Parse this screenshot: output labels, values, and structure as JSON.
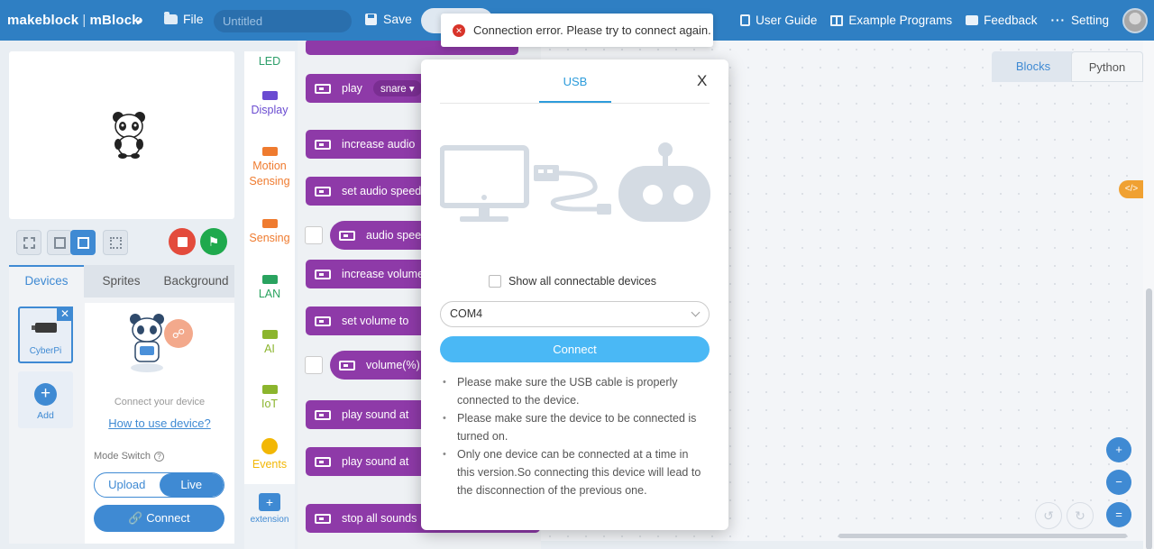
{
  "topbar": {
    "brand": "makeblock",
    "product": "mBlock",
    "file_label": "File",
    "title_placeholder": "Untitled",
    "save_label": "Save",
    "user_guide": "User Guide",
    "example_programs": "Example Programs",
    "feedback": "Feedback",
    "setting": "Setting"
  },
  "toast": {
    "message": "Connection error. Please try to connect again."
  },
  "devices": {
    "tabs": [
      "Devices",
      "Sprites",
      "Background"
    ],
    "device_name": "CyberPi",
    "add_label": "Add",
    "connect_hint": "Connect your device",
    "how_to": "How to use device?",
    "mode_switch_label": "Mode Switch",
    "mode_options": [
      "Upload",
      "Live"
    ],
    "connect_label": "Connect"
  },
  "categories": [
    {
      "label": "LED",
      "color": "#2d9e6a"
    },
    {
      "label": "Display",
      "color": "#6a4bd1"
    },
    {
      "label": "Motion Sensing",
      "color": "#ef7b2f"
    },
    {
      "label": "Sensing",
      "color": "#ef7b2f"
    },
    {
      "label": "LAN",
      "color": "#29a35f"
    },
    {
      "label": "AI",
      "color": "#8bb52d"
    },
    {
      "label": "IoT",
      "color": "#8bb52d"
    },
    {
      "label": "Events",
      "color": "#f2b705"
    }
  ],
  "extension_label": "extension",
  "blocks": [
    {
      "text": "play",
      "dropdown": "snare"
    },
    {
      "text": "increase audio"
    },
    {
      "text": "set audio speed"
    },
    {
      "text": "audio speed"
    },
    {
      "text": "increase volume"
    },
    {
      "text": "set volume to"
    },
    {
      "text": "volume(%)"
    },
    {
      "text": "play sound at"
    },
    {
      "text": "play sound at"
    },
    {
      "text": "stop all sounds"
    }
  ],
  "workspace_tabs": [
    "Blocks",
    "Python"
  ],
  "modal": {
    "tab_label": "USB",
    "close_label": "X",
    "show_all_label": "Show all connectable devices",
    "port_value": "COM4",
    "connect_label": "Connect",
    "tips": [
      "Please make sure the USB cable is properly connected to the device.",
      "Please make sure the device to be connected is turned on.",
      "Only one device can be connected at a time in this version.So connecting this device will lead to the disconnection of the previous one."
    ]
  },
  "colors": {
    "topbar": "#2f7fc3",
    "accent": "#3f8ad3",
    "modal_accent": "#2d9cdb",
    "connect_button": "#4ab8f5",
    "block_purple": "#8e3aa8",
    "error": "#d8342a"
  }
}
